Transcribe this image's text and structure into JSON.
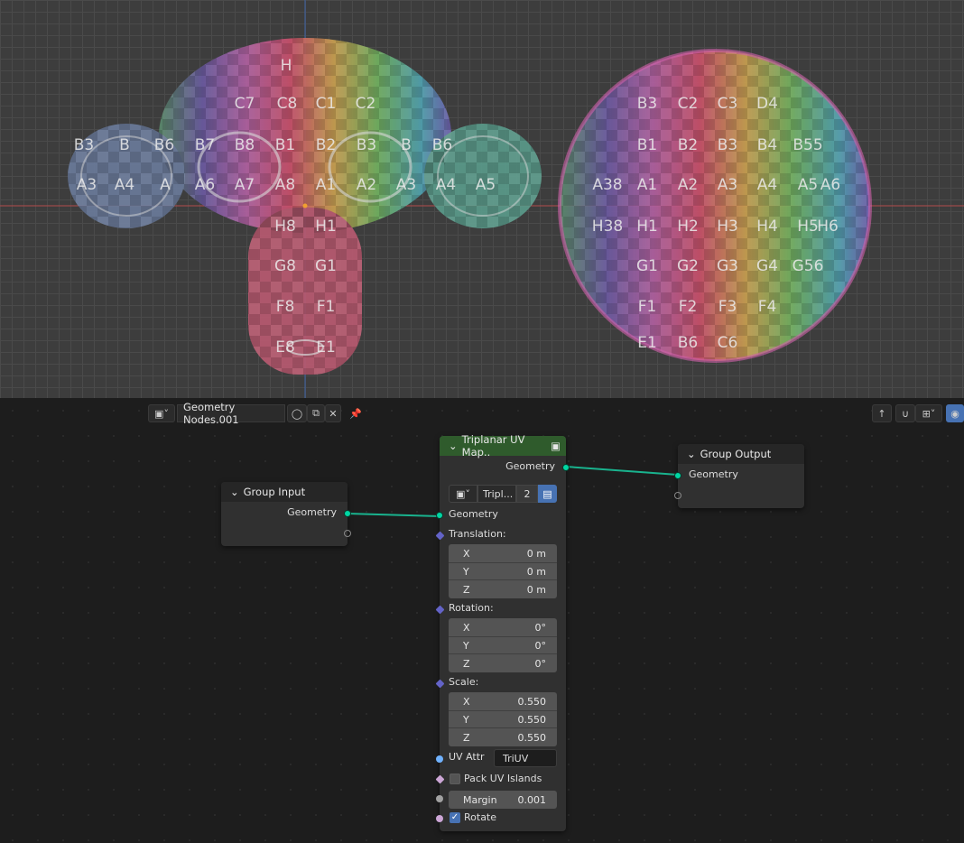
{
  "viewport": {
    "monkey_labels": [
      "H",
      "C7",
      "C8",
      "C1",
      "C2",
      "B3",
      "B",
      "B6",
      "B7",
      "B8",
      "B1",
      "B2",
      "B3",
      "B",
      "B6",
      "A3",
      "A4",
      "A",
      "A6",
      "A7",
      "A8",
      "A1",
      "A2",
      "A3",
      "A4",
      "A5",
      "H8",
      "H1",
      "G8",
      "G1",
      "F8",
      "F1",
      "E8",
      "E1"
    ],
    "sphere_labels": [
      "B3",
      "C2",
      "C3",
      "D4",
      "B1",
      "B2",
      "B3",
      "B4",
      "B55",
      "A38",
      "A1",
      "A2",
      "A3",
      "A4",
      "A5",
      "A6",
      "H38",
      "H1",
      "H2",
      "H3",
      "H4",
      "H5",
      "H6",
      "G1",
      "G2",
      "G3",
      "G4",
      "G56",
      "F1",
      "F2",
      "F3",
      "F4",
      "E1",
      "B6",
      "C6"
    ]
  },
  "header": {
    "tree_name": "Geometry Nodes.001",
    "editor_type_icon": "node-editor-icon",
    "fake_user_icon": "shield-icon",
    "duplicate_icon": "copy-icon",
    "unlink_icon": "close-icon",
    "pin_icon": "pin-icon"
  },
  "group_input": {
    "title": "Group Input",
    "outputs": [
      "Geometry"
    ]
  },
  "group_output": {
    "title": "Group Output",
    "inputs": [
      "Geometry"
    ]
  },
  "triplanar": {
    "title": "Triplanar UV Map..",
    "output_geometry": "Geometry",
    "group_name": "Tripl...",
    "users": "2",
    "input_geometry": "Geometry",
    "translation_label": "Translation:",
    "translation": [
      {
        "axis": "X",
        "value": "0 m"
      },
      {
        "axis": "Y",
        "value": "0 m"
      },
      {
        "axis": "Z",
        "value": "0 m"
      }
    ],
    "rotation_label": "Rotation:",
    "rotation": [
      {
        "axis": "X",
        "value": "0°"
      },
      {
        "axis": "Y",
        "value": "0°"
      },
      {
        "axis": "Z",
        "value": "0°"
      }
    ],
    "scale_label": "Scale:",
    "scale": [
      {
        "axis": "X",
        "value": "0.550"
      },
      {
        "axis": "Y",
        "value": "0.550"
      },
      {
        "axis": "Z",
        "value": "0.550"
      }
    ],
    "uv_attr_label": "UV Attr",
    "uv_attr_value": "TriUV",
    "pack_label": "Pack UV Islands",
    "pack_checked": false,
    "margin_label": "Margin",
    "margin_value": "0.001",
    "rotate_label": "Rotate",
    "rotate_checked": true
  },
  "colors": {
    "geometry_socket": "#00d6a3",
    "node_header_group": "#2f5b2c",
    "x_axis": "#c84a4a",
    "y_axis": "#3d6ec8"
  }
}
